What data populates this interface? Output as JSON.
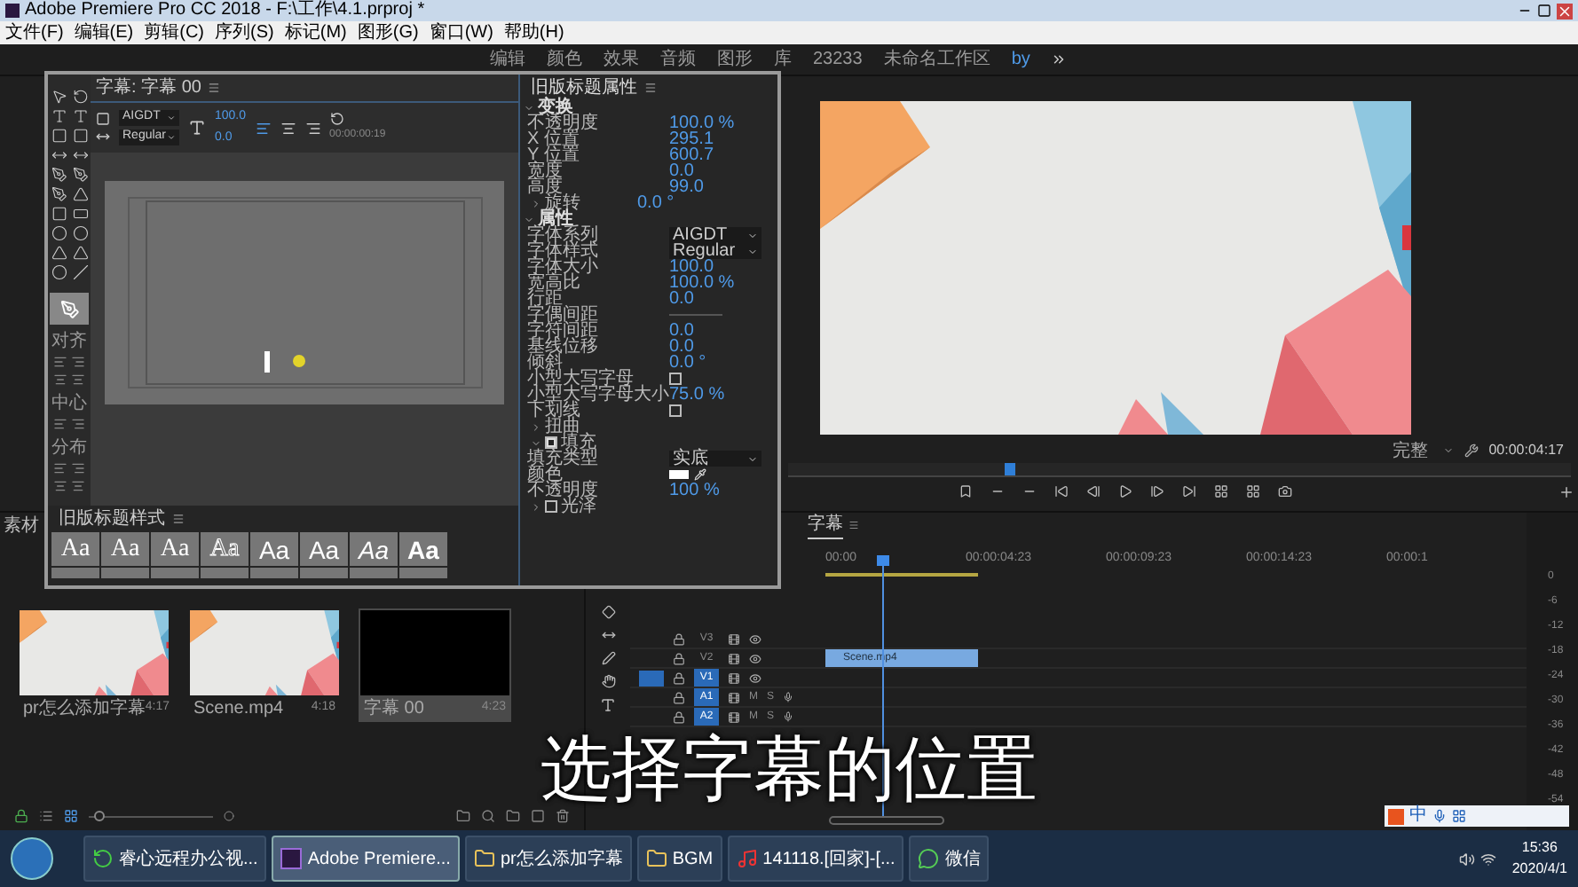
{
  "title_bar": {
    "title": "Adobe Premiere Pro CC 2018 - F:\\工作\\4.1.prproj *"
  },
  "menu": [
    "文件(F)",
    "编辑(E)",
    "剪辑(C)",
    "序列(S)",
    "标记(M)",
    "图形(G)",
    "窗口(W)",
    "帮助(H)"
  ],
  "workspaces": [
    {
      "label": "编辑",
      "selected": false
    },
    {
      "label": "颜色",
      "selected": false
    },
    {
      "label": "效果",
      "selected": false
    },
    {
      "label": "音频",
      "selected": false
    },
    {
      "label": "图形",
      "selected": false
    },
    {
      "label": "库",
      "selected": false
    },
    {
      "label": "23233",
      "selected": false
    },
    {
      "label": "未命名工作区",
      "selected": false
    },
    {
      "label": "by",
      "selected": true
    }
  ],
  "title_dialog": {
    "tab": "字幕: 字幕 00",
    "font_family": "AIGDT",
    "font_style": "Regular",
    "font_size": "100.0",
    "kerning": "0.0",
    "timecode": "00:00:00:19",
    "tool_groups": [
      "对齐",
      "中心",
      "分布"
    ],
    "styles_title": "旧版标题样式",
    "styles": [
      {
        "text": "Aa",
        "kind": "serif"
      },
      {
        "text": "Aa",
        "kind": "serif"
      },
      {
        "text": "Aa",
        "kind": "serif"
      },
      {
        "text": "Aa",
        "kind": "outline"
      },
      {
        "text": "Aa",
        "kind": "sans"
      },
      {
        "text": "Aa",
        "kind": "sans"
      },
      {
        "text": "Aa",
        "kind": "italic"
      },
      {
        "text": "Aa",
        "kind": "bold"
      }
    ],
    "properties_title": "旧版标题属性",
    "sections": [
      {
        "title": "变换",
        "expanded": true,
        "rows": [
          {
            "kind": "value",
            "label": "不透明度",
            "value": "100.0 %"
          },
          {
            "kind": "value",
            "label": "X 位置",
            "value": "295.1"
          },
          {
            "kind": "value",
            "label": "Y 位置",
            "value": "600.7"
          },
          {
            "kind": "value",
            "label": "宽度",
            "value": "0.0"
          },
          {
            "kind": "value",
            "label": "高度",
            "value": "99.0"
          },
          {
            "kind": "group",
            "label": "旋转",
            "value": "0.0 °",
            "expanded": false
          }
        ]
      },
      {
        "title": "属性",
        "expanded": true,
        "rows": [
          {
            "kind": "dropdown",
            "label": "字体系列",
            "value": "AIGDT"
          },
          {
            "kind": "dropdown",
            "label": "字体样式",
            "value": "Regular"
          },
          {
            "kind": "value",
            "label": "字体大小",
            "value": "100.0"
          },
          {
            "kind": "value",
            "label": "宽高比",
            "value": "100.0 %"
          },
          {
            "kind": "value",
            "label": "行距",
            "value": "0.0"
          },
          {
            "kind": "blank",
            "label": "字偶间距"
          },
          {
            "kind": "value",
            "label": "字符间距",
            "value": "0.0"
          },
          {
            "kind": "value",
            "label": "基线位移",
            "value": "0.0"
          },
          {
            "kind": "value",
            "label": "倾斜",
            "value": "0.0 °"
          },
          {
            "kind": "checkbox",
            "label": "小型大写字母",
            "checked": false
          },
          {
            "kind": "value",
            "label": "小型大写字母大小",
            "value": "75.0 %"
          },
          {
            "kind": "checkbox",
            "label": "下划线",
            "checked": false
          },
          {
            "kind": "group",
            "label": "扭曲",
            "expanded": false
          },
          {
            "kind": "checkgroup",
            "label": "填充",
            "checked": true,
            "expanded": true
          },
          {
            "kind": "dropdown",
            "label": "填充类型",
            "value": "实底"
          },
          {
            "kind": "swatch",
            "label": "颜色",
            "color": "#ffffff"
          },
          {
            "kind": "value",
            "label": "不透明度",
            "value": "100 %"
          },
          {
            "kind": "checkgroup",
            "label": "光泽",
            "checked": false,
            "expanded": false
          }
        ]
      }
    ]
  },
  "project": {
    "tab": "素材",
    "zoom": {
      "level": 0.05
    },
    "clips": [
      {
        "name": "pr怎么添加字幕",
        "duration": "4:17",
        "kind": "video",
        "selected": false
      },
      {
        "name": "Scene.mp4",
        "duration": "4:18",
        "kind": "video",
        "selected": false
      },
      {
        "name": "字幕 00",
        "duration": "4:23",
        "kind": "title",
        "selected": true
      }
    ]
  },
  "program": {
    "zoom": "完整",
    "timecode": "00:00:04:17"
  },
  "timeline": {
    "tab": "字幕",
    "ruler": [
      "00:00",
      "00:00:04:23",
      "00:00:09:23",
      "00:00:14:23",
      "00:00:1"
    ],
    "tracks": [
      {
        "name": "V3",
        "kind": "video",
        "targeted": false
      },
      {
        "name": "V2",
        "kind": "video",
        "targeted": false,
        "clip": "Scene.mp4"
      },
      {
        "name": "V1",
        "kind": "video",
        "targeted": true
      },
      {
        "name": "A1",
        "kind": "audio",
        "targeted": true,
        "buttons": [
          "M",
          "S"
        ]
      },
      {
        "name": "A2",
        "kind": "audio",
        "targeted": true,
        "buttons": [
          "M",
          "S"
        ]
      }
    ],
    "meter_scale": [
      "0",
      "-6",
      "-12",
      "-18",
      "-24",
      "-30",
      "-36",
      "-42",
      "-48",
      "-54"
    ]
  },
  "caption": "选择字幕的位置",
  "ime": {
    "label": "中"
  },
  "taskbar": {
    "items": [
      {
        "label": "睿心远程办公视...",
        "kind": "app",
        "selected": false
      },
      {
        "label": "Adobe Premiere...",
        "kind": "premiere",
        "selected": true
      },
      {
        "label": "pr怎么添加字幕",
        "kind": "folder",
        "selected": false
      },
      {
        "label": "BGM",
        "kind": "folder",
        "selected": false
      },
      {
        "label": "141118.[回家]-[...",
        "kind": "music",
        "selected": false
      },
      {
        "label": "微信",
        "kind": "chat",
        "selected": false
      }
    ],
    "time": "15:36",
    "date": "2020/4/1"
  }
}
